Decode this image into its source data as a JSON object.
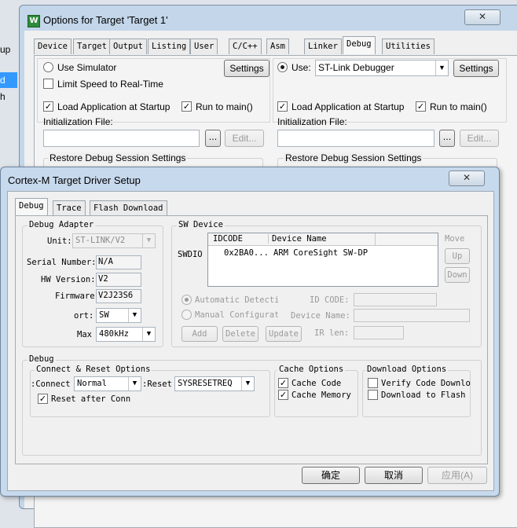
{
  "bg_left": {
    "items": [
      "up",
      "d",
      "h"
    ]
  },
  "options_window": {
    "title": "Options for Target 'Target 1'",
    "tabs": [
      "Device",
      "Target",
      "Output",
      "Listing",
      "User",
      "C/C++",
      "Asm",
      "Linker",
      "Debug",
      "Utilities"
    ],
    "selected_tab": "Debug",
    "left": {
      "use_simulator": "Use Simulator",
      "settings": "Settings",
      "limit_speed": "Limit Speed to Real-Time",
      "load_app": "Load Application at Startup",
      "run_to_main": "Run to main()",
      "init_file": "Initialization File:",
      "browse": "...",
      "edit": "Edit...",
      "restore": "Restore Debug Session Settings"
    },
    "right": {
      "use": "Use:",
      "debugger": "ST-Link Debugger",
      "settings": "Settings",
      "load_app": "Load Application at Startup",
      "run_to_main": "Run to main()",
      "init_file": "Initialization File:",
      "browse": "...",
      "edit": "Edit...",
      "restore": "Restore Debug Session Settings"
    }
  },
  "driver_dialog": {
    "title": "Cortex-M Target Driver Setup",
    "close": "✕",
    "tabs": [
      "Debug",
      "Trace",
      "Flash Download"
    ],
    "adapter": {
      "title": "Debug Adapter",
      "unit_label": "Unit:",
      "unit_value": "ST-LINK/V2",
      "serial_label": "Serial Number:",
      "serial_value": "N/A",
      "hw_label": "HW Version:",
      "hw_value": "V2",
      "fw_label": "Firmware",
      "fw_value": "V2J23S6",
      "port_label": "ort:",
      "port_value": "SW",
      "max_label": "Max",
      "max_value": "480kHz"
    },
    "sw_device": {
      "title": "SW Device",
      "swdio": "SWDIO",
      "col_idcode": "IDCODE",
      "col_name": "Device Name",
      "rows": [
        {
          "idcode": "0x2BA0...",
          "name": "ARM CoreSight SW-DP"
        }
      ],
      "move": "Move",
      "up": "Up",
      "down": "Down",
      "auto_detect": "Automatic Detectic",
      "manual_config": "Manual Configurati",
      "id_code_label": "ID CODE:",
      "device_name_label": "Device Name:",
      "add": "Add",
      "delete": "Delete",
      "update": "Update",
      "ir_len": "IR len:"
    },
    "debug_group": {
      "title": "Debug",
      "connect_reset": {
        "title": "Connect & Reset Options",
        "connect_label": "Connect:",
        "connect_value": "Normal",
        "reset_label": "Reset:",
        "reset_value": "SYSRESETREQ",
        "reset_after": "Reset after Conn"
      },
      "cache": {
        "title": "Cache Options",
        "code": "Cache Code",
        "memory": "Cache Memory"
      },
      "download": {
        "title": "Download Options",
        "verify": "Verify Code Downlo",
        "flash": "Download to Flash"
      }
    },
    "ok": "确定",
    "cancel": "取消",
    "apply": "应用(A)"
  }
}
